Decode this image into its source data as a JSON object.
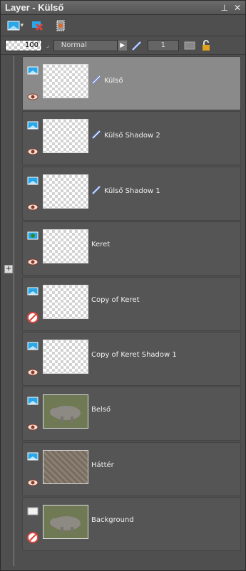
{
  "panel": {
    "title": "Layer - Külső"
  },
  "properties": {
    "opacity": "100",
    "blend_mode": "Normal",
    "link_value": "1"
  },
  "layers": [
    {
      "name": "Külső",
      "icon": "raster-layer-icon",
      "visibility": "eye-icon",
      "linked": true,
      "thumb": "transparent",
      "selected": true
    },
    {
      "name": "Külső Shadow 2",
      "icon": "raster-layer-icon",
      "visibility": "eye-icon",
      "linked": true,
      "thumb": "transparent"
    },
    {
      "name": "Külső Shadow 1",
      "icon": "raster-layer-icon",
      "visibility": "eye-icon",
      "linked": true,
      "thumb": "transparent"
    },
    {
      "name": "Keret",
      "icon": "vector-layer-icon",
      "visibility": "eye-icon",
      "linked": false,
      "thumb": "transparent"
    },
    {
      "name": "Copy of Keret",
      "icon": "raster-layer-icon",
      "visibility": "hidden-eye-icon",
      "linked": false,
      "thumb": "transparent"
    },
    {
      "name": "Copy of Keret Shadow 1",
      "icon": "raster-layer-icon",
      "visibility": "eye-icon",
      "linked": false,
      "thumb": "transparent"
    },
    {
      "name": "Belső",
      "icon": "raster-layer-icon",
      "visibility": "eye-icon",
      "linked": false,
      "thumb": "photo"
    },
    {
      "name": "Háttér",
      "icon": "raster-layer-icon",
      "visibility": "eye-icon",
      "linked": false,
      "thumb": "texture"
    },
    {
      "name": "Background",
      "icon": "background-layer-icon",
      "visibility": "hidden-eye-icon",
      "linked": false,
      "thumb": "photo"
    }
  ],
  "colors": {
    "panel_bg": "#4f4f4f",
    "selected_row": "#8a8a8a",
    "link_blue": "#6b8fe6",
    "delete_red": "#d9443a"
  }
}
